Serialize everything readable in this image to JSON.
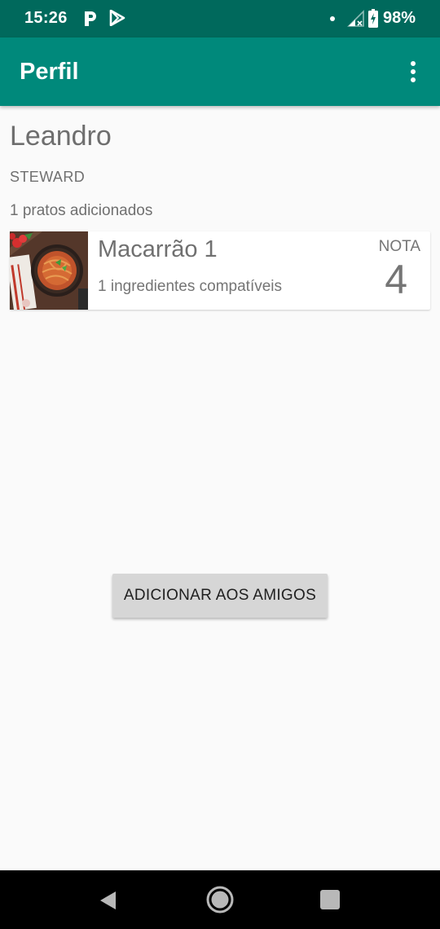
{
  "status_bar": {
    "time": "15:26",
    "battery": "98%",
    "icons": [
      "parking-p-icon",
      "play-store-icon",
      "notification-dot-icon",
      "signal-icon",
      "battery-charging-icon"
    ]
  },
  "app_bar": {
    "title": "Perfil",
    "menu_icon": "overflow-menu-icon"
  },
  "profile": {
    "name": "Leandro",
    "role": "STEWARD",
    "dishes_count": "1 pratos adicionados"
  },
  "dishes": [
    {
      "name": "Macarrão 1",
      "ingredients": "1 ingredientes compatíveis",
      "nota_label": "NOTA",
      "nota_value": "4",
      "image": "spaghetti-dish-photo"
    }
  ],
  "actions": {
    "add_friend_label": "ADICIONAR AOS AMIGOS"
  },
  "nav_bar": {
    "icons": [
      "back-icon",
      "home-icon",
      "recents-icon"
    ]
  },
  "colors": {
    "status_bar": "#00695c",
    "app_bar": "#00897b",
    "background": "#fafafa",
    "button": "#d6d6d6"
  }
}
